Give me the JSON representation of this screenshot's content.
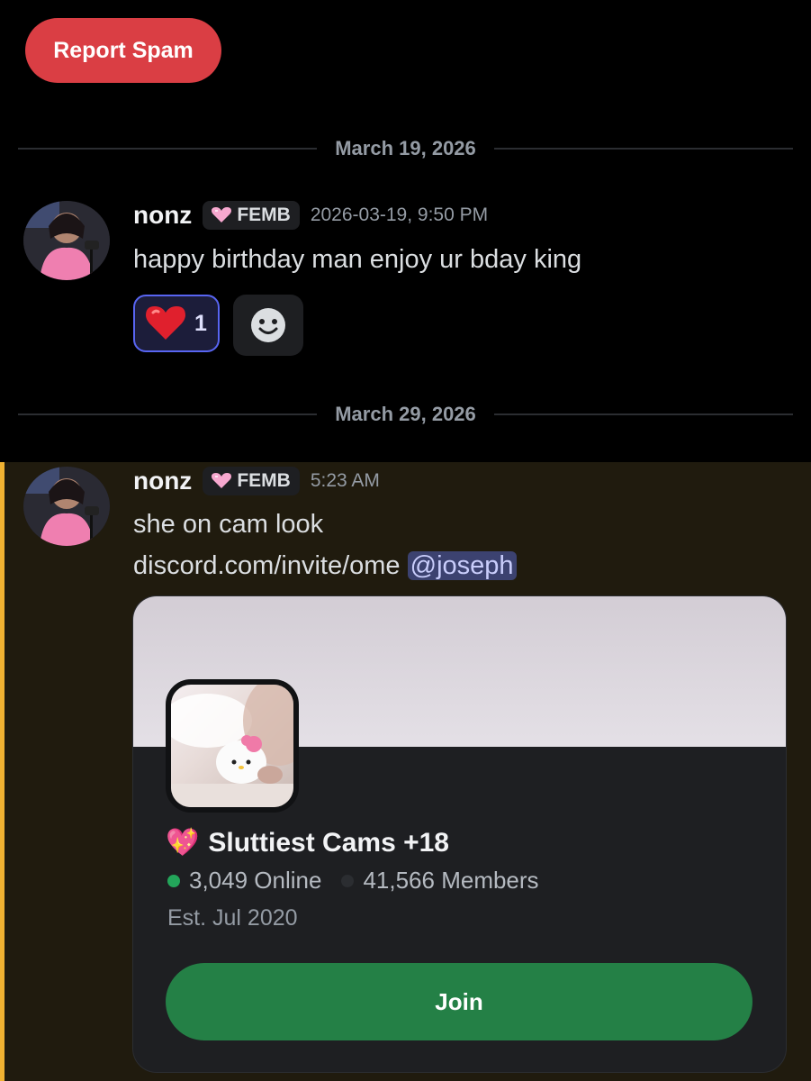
{
  "report_button": "Report Spam",
  "dividers": [
    "March 19, 2026",
    "March 29, 2026"
  ],
  "messages": [
    {
      "username": "nonz",
      "tag": "FEMB",
      "timestamp": "2026-03-19, 9:50 PM",
      "text": "happy birthday man enjoy ur bday king",
      "reactions": [
        {
          "emoji": "❤️",
          "count": "1"
        }
      ],
      "add_reaction_icon": "emoji-smile-icon"
    },
    {
      "username": "nonz",
      "tag": "FEMB",
      "timestamp": "5:23 AM",
      "text_line1": "she on cam look",
      "link": "discord.com/invite/ome",
      "mention": "@joseph",
      "highlighted": true
    }
  ],
  "invite": {
    "server_emoji": "💖",
    "server_name": "Sluttiest Cams +18",
    "online": "3,049 Online",
    "members": "41,566 Members",
    "established": "Est. Jul 2020",
    "join_label": "Join"
  },
  "colors": {
    "report": "#da3e44",
    "mention_bg": "#3c4270",
    "highlight_bar": "#f0b232",
    "join": "#248046",
    "online_dot": "#23a55a"
  }
}
